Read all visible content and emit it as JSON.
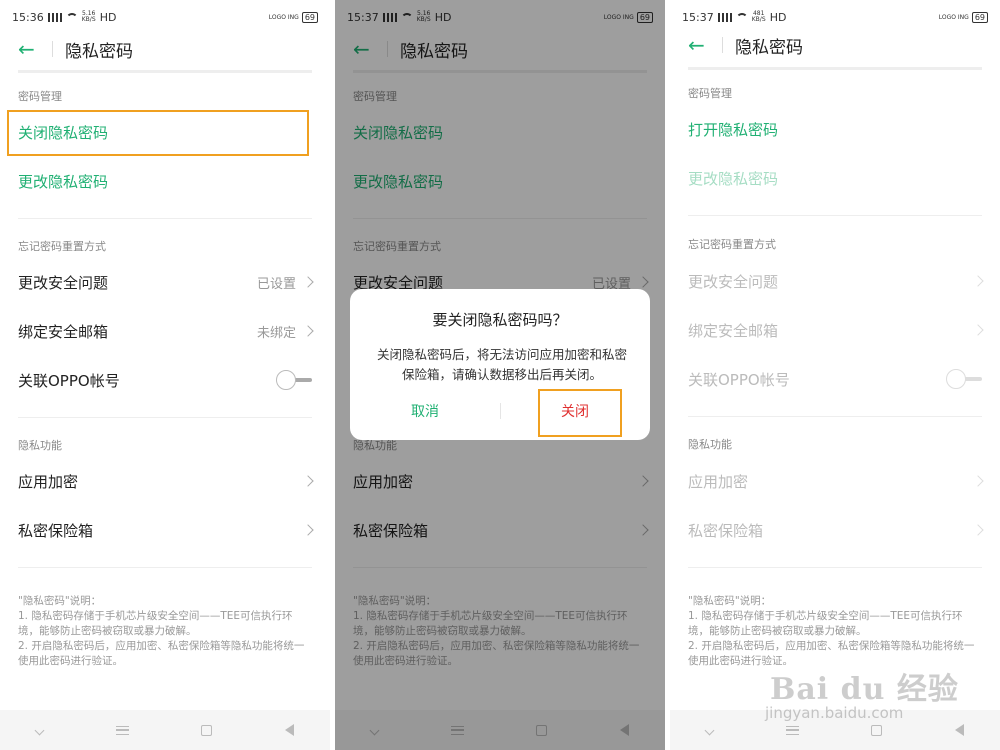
{
  "screens": [
    {
      "status": {
        "time": "15:36",
        "net": "5.16 KB/S",
        "hd": "HD",
        "logo": "LOGO ING",
        "battery": "69"
      },
      "title": "隐私密码",
      "sections": {
        "pwd": "密码管理",
        "forgot": "忘记密码重置方式",
        "priv": "隐私功能"
      },
      "items": {
        "close": "关闭隐私密码",
        "change": "更改隐私密码",
        "security_q": "更改安全问题",
        "security_q_val": "已设置",
        "email": "绑定安全邮箱",
        "email_val": "未绑定",
        "oppo": "关联OPPO帐号",
        "app_lock": "应用加密",
        "safe_box": "私密保险箱"
      },
      "note": {
        "title": "\"隐私密码\"说明：",
        "l1": "1. 隐私密码存储于手机芯片级安全空间——TEE可信执行环境，能够防止密码被窃取或暴力破解。",
        "l2": "2. 开启隐私密码后，应用加密、私密保险箱等隐私功能将统一使用此密码进行验证。"
      }
    },
    {
      "status": {
        "time": "15:37",
        "net": "5.16 KB/S",
        "hd": "HD",
        "logo": "LOGO ING",
        "battery": "69"
      },
      "title": "隐私密码",
      "sections": {
        "pwd": "密码管理",
        "forgot": "忘记密码重置方式",
        "priv": "隐私功能"
      },
      "items": {
        "close": "关闭隐私密码",
        "change": "更改隐私密码",
        "security_q": "更改安全问题",
        "security_q_val": "已设置",
        "app_lock": "应用加密",
        "safe_box": "私密保险箱"
      },
      "note": {
        "title": "\"隐私密码\"说明：",
        "l1": "1. 隐私密码存储于手机芯片级安全空间——TEE可信执行环境，能够防止密码被窃取或暴力破解。",
        "l2": "2. 开启隐私密码后，应用加密、私密保险箱等隐私功能将统一使用此密码进行验证。"
      },
      "dialog": {
        "title": "要关闭隐私密码吗？",
        "message": "关闭隐私密码后，将无法访问应用加密和私密保险箱，请确认数据移出后再关闭。",
        "cancel": "取消",
        "confirm": "关闭"
      }
    },
    {
      "status": {
        "time": "15:37",
        "net": "481 KB/S",
        "hd": "HD",
        "logo": "LOGO ING",
        "battery": "69"
      },
      "title": "隐私密码",
      "sections": {
        "pwd": "密码管理",
        "forgot": "忘记密码重置方式",
        "priv": "隐私功能"
      },
      "items": {
        "open": "打开隐私密码",
        "change": "更改隐私密码",
        "security_q": "更改安全问题",
        "email": "绑定安全邮箱",
        "oppo": "关联OPPO帐号",
        "app_lock": "应用加密",
        "safe_box": "私密保险箱"
      },
      "note": {
        "title": "\"隐私密码\"说明：",
        "l1": "1. 隐私密码存储于手机芯片级安全空间——TEE可信执行环境，能够防止密码被窃取或暴力破解。",
        "l2": "2. 开启隐私密码后，应用加密、私密保险箱等隐私功能将统一使用此密码进行验证。"
      }
    }
  ],
  "watermark": {
    "logo": "Bai du 经验",
    "url": "jingyan.baidu.com"
  },
  "colors": {
    "accent": "#20b073",
    "danger": "#e03030",
    "highlight": "#f0a020"
  }
}
